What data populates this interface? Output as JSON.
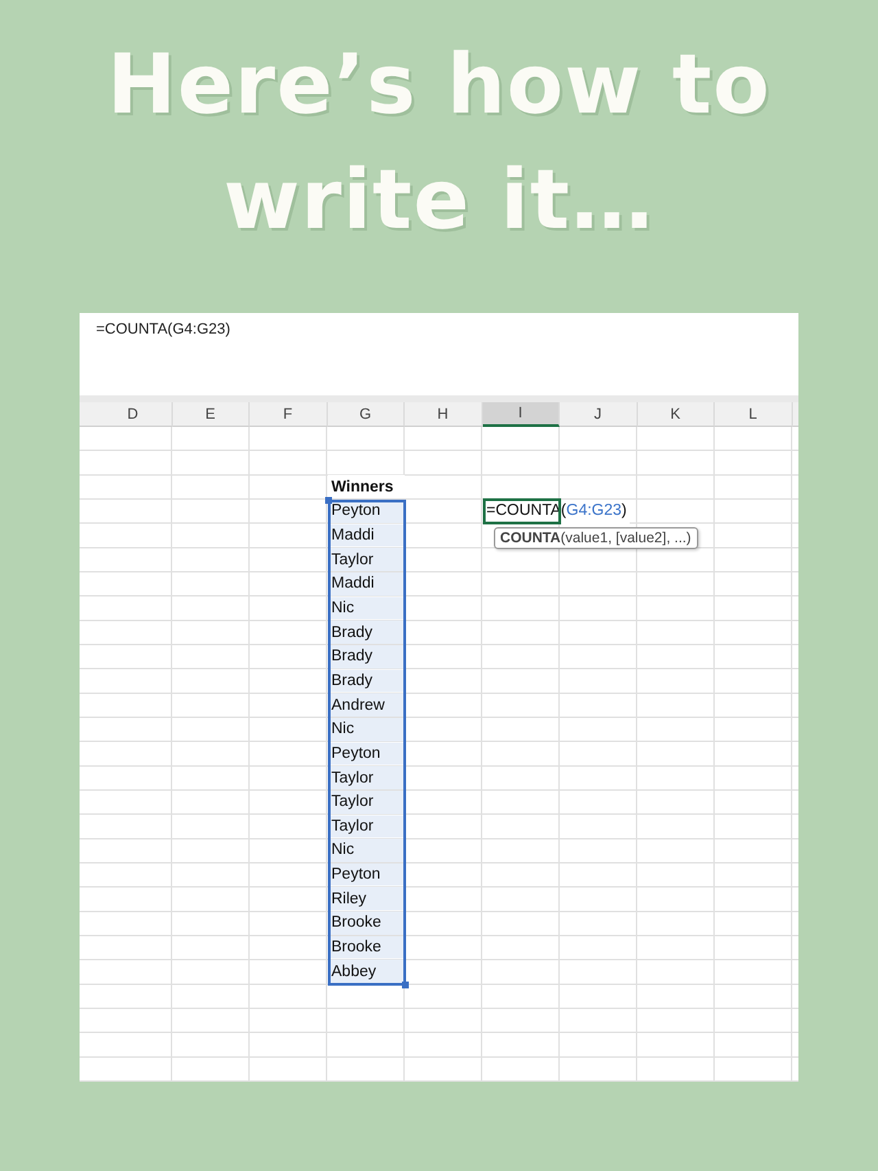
{
  "title": {
    "lines": [
      "Here’s how to",
      "write it…"
    ]
  },
  "formula_bar": {
    "text": "=COUNTA(G4:G23)"
  },
  "columns": [
    {
      "label": "D",
      "selected": false
    },
    {
      "label": "E",
      "selected": false
    },
    {
      "label": "F",
      "selected": false
    },
    {
      "label": "G",
      "selected": false
    },
    {
      "label": "H",
      "selected": false
    },
    {
      "label": "I",
      "selected": true
    },
    {
      "label": "J",
      "selected": false
    },
    {
      "label": "K",
      "selected": false
    },
    {
      "label": "L",
      "selected": false
    }
  ],
  "winners": {
    "header": "Winners",
    "selected": true,
    "names": [
      "Peyton",
      "Maddi",
      "Taylor",
      "Maddi",
      "Nic",
      "Brady",
      "Brady",
      "Brady",
      "Andrew",
      "Nic",
      "Peyton",
      "Taylor",
      "Taylor",
      "Taylor",
      "Nic",
      "Peyton",
      "Riley",
      "Brooke",
      "Brooke",
      "Abbey"
    ]
  },
  "active_cell": {
    "prefix": "=COUNTA(",
    "range": "G4:G23",
    "suffix": ")"
  },
  "tooltip": {
    "text": "**COUNTA**(value1, [value2], ...)"
  }
}
